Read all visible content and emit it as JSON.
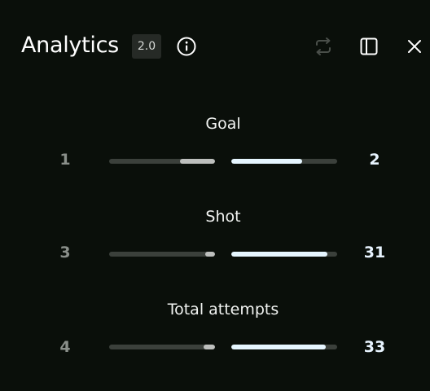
{
  "header": {
    "title": "Analytics",
    "version": "2.0",
    "icons": {
      "info": "info-icon",
      "swap": "swap-icon",
      "sidebar": "sidebar-toggle-icon",
      "close": "close-icon"
    }
  },
  "stats": [
    {
      "label": "Goal",
      "left_value": "1",
      "right_value": "2",
      "left_fill": 0.33,
      "right_fill": 0.67
    },
    {
      "label": "Shot",
      "left_value": "3",
      "right_value": "31",
      "left_fill": 0.09,
      "right_fill": 0.91
    },
    {
      "label": "Total attempts",
      "left_value": "4",
      "right_value": "33",
      "left_fill": 0.11,
      "right_fill": 0.89
    }
  ],
  "colors": {
    "background": "#0a0f0a",
    "track": "#3b403b",
    "left_fill": "#bdbfbd",
    "right_fill": "#e6f6ff"
  }
}
